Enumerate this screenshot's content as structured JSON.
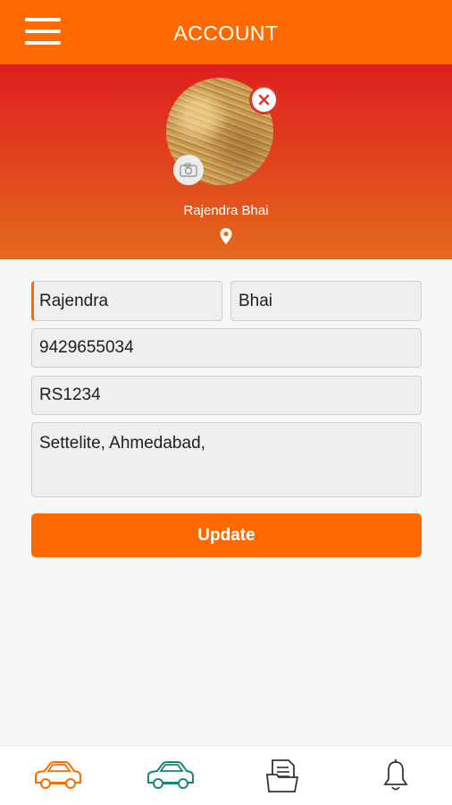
{
  "header": {
    "title": "ACCOUNT",
    "menu_icon": "hamburger-menu-icon"
  },
  "profile": {
    "name": "Rajendra Bhai",
    "remove_icon": "close-circle-icon",
    "camera_icon": "camera-icon",
    "location_icon": "location-pin-icon"
  },
  "form": {
    "first_name": "Rajendra",
    "last_name": "Bhai",
    "phone": "9429655034",
    "vehicle_number": "RS1234",
    "address": "Settelite, Ahmedabad,",
    "update_label": "Update"
  },
  "nav": {
    "items": [
      {
        "icon": "car-icon",
        "color": "#ff6a00"
      },
      {
        "icon": "car-icon",
        "color": "#16857a"
      },
      {
        "icon": "documents-icon",
        "color": "#333333"
      },
      {
        "icon": "bell-icon",
        "color": "#333333"
      }
    ]
  },
  "colors": {
    "primary": "#ff6a00",
    "banner_top": "#dd1f1f",
    "banner_bottom": "#e46a1d",
    "accent_teal": "#16857a"
  }
}
